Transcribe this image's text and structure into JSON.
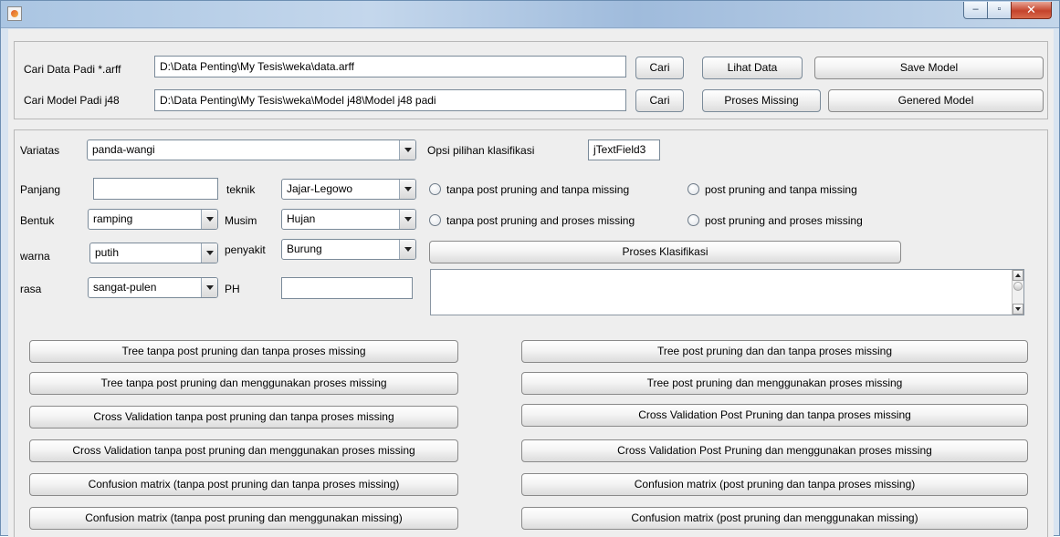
{
  "window": {
    "title": "",
    "buttons": {
      "minimize": "–",
      "maximize": "▫",
      "close": "✕"
    }
  },
  "top_panel": {
    "data_label": "Cari Data Padi *.arff",
    "data_path": "D:\\Data Penting\\My Tesis\\weka\\data.arff",
    "model_label": "Cari Model Padi j48",
    "model_path": "D:\\Data Penting\\My Tesis\\weka\\Model j48\\Model j48 padi",
    "cari_data_button": "Cari",
    "cari_model_button": "Cari",
    "lihat_data_button": "Lihat Data",
    "proses_missing_button": "Proses Missing",
    "save_model_button": "Save Model",
    "genered_model_button": "Genered Model"
  },
  "form": {
    "variatas": {
      "label": "Variatas",
      "value": "panda-wangi"
    },
    "opsi": {
      "label": "Opsi pilihan klasifikasi",
      "value": "jTextField3"
    },
    "panjang": {
      "label": "Panjang",
      "value": ""
    },
    "teknik": {
      "label": "teknik",
      "value": "Jajar-Legowo"
    },
    "bentuk": {
      "label": "Bentuk",
      "value": "ramping"
    },
    "musim": {
      "label": "Musim",
      "value": "Hujan"
    },
    "warna": {
      "label": "warna",
      "value": "putih"
    },
    "penyakit": {
      "label": "penyakit",
      "value": "Burung"
    },
    "rasa": {
      "label": "rasa",
      "value": "sangat-pulen"
    },
    "ph": {
      "label": "PH",
      "value": ""
    }
  },
  "radio_options": [
    "tanpa post pruning and tanpa missing",
    "post pruning and tanpa missing",
    "tanpa post pruning and proses missing",
    "post pruning and proses missing"
  ],
  "proses_klasifikasi_button": "Proses Klasifikasi",
  "result_area": {
    "text": ""
  },
  "action_buttons": {
    "left": [
      "Tree tanpa post pruning dan tanpa proses missing",
      "Tree tanpa post pruning dan menggunakan proses missing",
      "Cross Validation tanpa post pruning dan tanpa proses missing",
      "Cross Validation tanpa post pruning dan menggunakan proses missing",
      "Confusion matrix (tanpa post pruning dan tanpa proses missing)",
      "Confusion matrix (tanpa post pruning dan menggunakan missing)"
    ],
    "right": [
      "Tree post pruning dan dan tanpa proses missing",
      "Tree post pruning dan menggunakan proses missing",
      "Cross Validation Post Pruning dan tanpa proses missing",
      "Cross Validation Post Pruning dan menggunakan proses missing",
      "Confusion matrix (post pruning dan tanpa proses missing)",
      "Confusion matrix (post pruning dan menggunakan missing)"
    ]
  }
}
